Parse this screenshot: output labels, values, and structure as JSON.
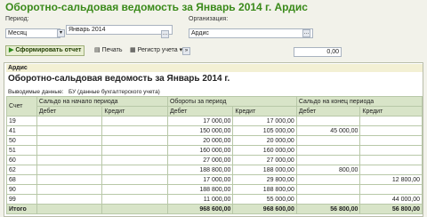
{
  "window": {
    "title": "Оборотно-сальдовая ведомость за Январь 2014 г. Ардис"
  },
  "form": {
    "period_label": "Период:",
    "period_type": "Месяц",
    "period_value": "Январь 2014",
    "org_label": "Организация:",
    "org_value": "Ардис",
    "amount_value": "0,00"
  },
  "toolbar": {
    "generate": "Сформировать отчет",
    "print": "Печать",
    "register": "Регистр учета"
  },
  "report": {
    "org_name": "Ардис",
    "title": "Оборотно-сальдовая ведомость за Январь 2014 г.",
    "output_label": "Выводимые данные:",
    "output_value": "БУ (данные бухгалтерского учета)",
    "headers": {
      "account": "Счет",
      "opening": "Сальдо на начало периода",
      "turnover": "Обороты за период",
      "closing": "Сальдо на конец периода",
      "debit": "Дебет",
      "credit": "Кредит"
    },
    "rows": [
      [
        "19",
        "",
        "",
        "17 000,00",
        "17 000,00",
        "",
        ""
      ],
      [
        "41",
        "",
        "",
        "150 000,00",
        "105 000,00",
        "45 000,00",
        ""
      ],
      [
        "50",
        "",
        "",
        "20 000,00",
        "20 000,00",
        "",
        ""
      ],
      [
        "51",
        "",
        "",
        "160 000,00",
        "160 000,00",
        "",
        ""
      ],
      [
        "60",
        "",
        "",
        "27 000,00",
        "27 000,00",
        "",
        ""
      ],
      [
        "62",
        "",
        "",
        "188 800,00",
        "188 000,00",
        "800,00",
        ""
      ],
      [
        "68",
        "",
        "",
        "17 000,00",
        "29 800,00",
        "",
        "12 800,00"
      ],
      [
        "90",
        "",
        "",
        "188 800,00",
        "188 800,00",
        "",
        ""
      ],
      [
        "99",
        "",
        "",
        "11 000,00",
        "55 000,00",
        "",
        "44 000,00"
      ]
    ],
    "total": [
      "Итого",
      "",
      "",
      "968 600,00",
      "968 600,00",
      "56 800,00",
      "56 800,00"
    ]
  }
}
